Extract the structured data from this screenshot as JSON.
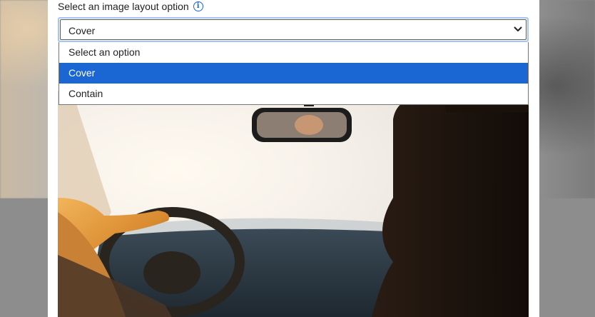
{
  "form": {
    "label": "Select an image layout option",
    "info_icon": "info-icon",
    "select": {
      "value": "Cover",
      "icon": "chevron-down-icon"
    },
    "options": [
      {
        "label": "Select an option",
        "selected": false
      },
      {
        "label": "Cover",
        "selected": true
      },
      {
        "label": "Contain",
        "selected": false
      }
    ]
  },
  "colors": {
    "accent": "#1a67d4",
    "focus_ring": "#a6c4f4",
    "info_icon": "#1b63d8"
  }
}
